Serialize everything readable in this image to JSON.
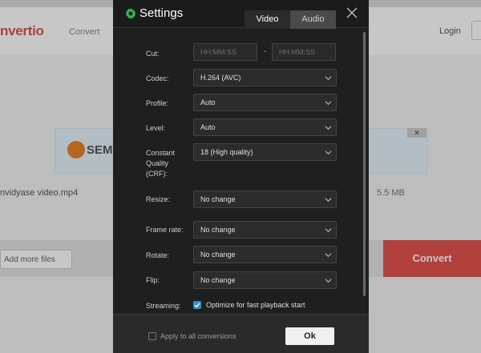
{
  "background": {
    "logo": "nvertio",
    "nav": "Convert",
    "login": "Login",
    "ad_text": "SEM",
    "ad_close": "✕",
    "filename": "nvidyase video.mp4",
    "filesize": "5.5 MB",
    "add_more": "Add more files",
    "convert": "Convert"
  },
  "modal": {
    "title": "Settings",
    "tabs": [
      "Video",
      "Audio"
    ],
    "active_tab": "Video",
    "close_icon": "close-icon",
    "accent_color": "#37b24d",
    "fields": {
      "cut": {
        "label": "Cut:",
        "start_placeholder": "HH:MM:SS",
        "separator": "-",
        "end_placeholder": "HH:MM:SS"
      },
      "codec": {
        "label": "Codec:",
        "value": "H.264 (AVC)"
      },
      "profile": {
        "label": "Profile:",
        "value": "Auto"
      },
      "level": {
        "label": "Level:",
        "value": "Auto"
      },
      "crf": {
        "label_line1": "Constant",
        "label_line2": "Quality",
        "label_line3": "(CRF):",
        "value": "18 (High quality)"
      },
      "resize": {
        "label": "Resize:",
        "value": "No change"
      },
      "frame_rate": {
        "label": "Frame rate:",
        "value": "No change"
      },
      "rotate": {
        "label": "Rotate:",
        "value": "No change"
      },
      "flip": {
        "label": "Flip:",
        "value": "No change"
      },
      "streaming": {
        "label": "Streaming:",
        "checkbox_label": "Optimize for fast playback start",
        "checked": true
      }
    },
    "footer": {
      "apply_all": "Apply to all conversions",
      "apply_checked": false,
      "ok": "Ok"
    }
  }
}
